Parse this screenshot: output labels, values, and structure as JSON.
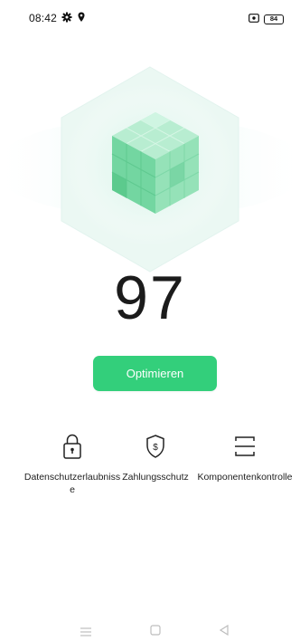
{
  "status_bar": {
    "time": "08:42",
    "battery": "84"
  },
  "security": {
    "score": "97"
  },
  "actions": {
    "optimize_label": "Optimieren"
  },
  "features": [
    {
      "label": "Datenschutzerlaubnisse",
      "icon": "lock-icon"
    },
    {
      "label": "Zahlungsschutz",
      "icon": "shield-dollar-icon"
    },
    {
      "label": "Komponentenkontrolle",
      "icon": "scan-icon"
    }
  ],
  "nav_icons": [
    "menu-icon",
    "home-icon",
    "back-icon"
  ],
  "colors": {
    "accent": "#33cf7b",
    "cube_light": "#bff0d6",
    "cube_mid": "#7fdca8",
    "cube_dark": "#4cc98a"
  }
}
